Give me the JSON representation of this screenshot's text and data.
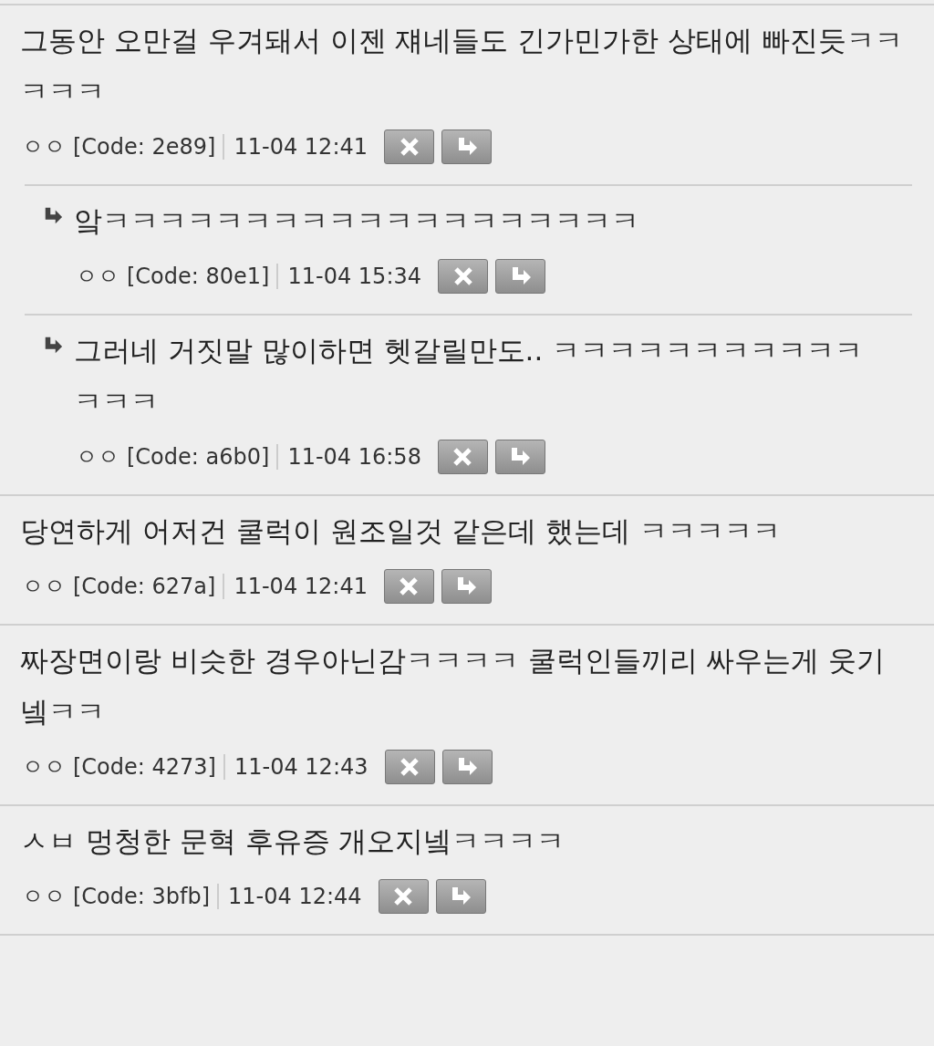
{
  "comments": [
    {
      "text": "그동안 오만걸 우겨돼서 이젠 쟤네들도 긴가민가한 상태에 빠진듯ㅋㅋㅋㅋㅋ",
      "author": "ㅇㅇ",
      "code": "[Code: 2e89]",
      "time": "11-04 12:41",
      "replies": [
        {
          "text": "앜ㅋㅋㅋㅋㅋㅋㅋㅋㅋㅋㅋㅋㅋㅋㅋㅋㅋㅋㅋ",
          "author": "ㅇㅇ",
          "code": "[Code: 80e1]",
          "time": "11-04 15:34"
        },
        {
          "text": "그러네 거짓말 많이하면 헷갈릴만도.. ㅋㅋㅋㅋㅋㅋㅋㅋㅋㅋㅋㅋㅋㅋ",
          "author": "ㅇㅇ",
          "code": "[Code: a6b0]",
          "time": "11-04 16:58"
        }
      ]
    },
    {
      "text": "당연하게 어저건 쿨럭이 원조일것 같은데 했는데 ㅋㅋㅋㅋㅋ",
      "author": "ㅇㅇ",
      "code": "[Code: 627a]",
      "time": "11-04 12:41"
    },
    {
      "text": "짜장면이랑 비슷한 경우아닌감ㅋㅋㅋㅋ 쿨럭인들끼리 싸우는게 웃기넼ㅋㅋ",
      "author": "ㅇㅇ",
      "code": "[Code: 4273]",
      "time": "11-04 12:43"
    },
    {
      "text": "ㅅㅂ 멍청한 문혁 후유증 개오지넼ㅋㅋㅋㅋ",
      "author": "ㅇㅇ",
      "code": "[Code: 3bfb]",
      "time": "11-04 12:44"
    }
  ]
}
